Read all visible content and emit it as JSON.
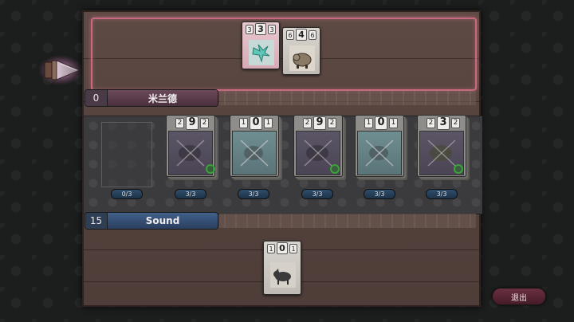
{
  "opponent": {
    "count": "0",
    "name": "米兰德",
    "hand": [
      {
        "left": "3",
        "mid": "3",
        "right": "3",
        "art": "cyan-bird-icon"
      },
      {
        "left": "6",
        "mid": "4",
        "right": "6",
        "art": "boar-icon"
      }
    ]
  },
  "player": {
    "count": "15",
    "name": "Sound",
    "hand": [
      {
        "left": "1",
        "mid": "0",
        "right": "1",
        "art": "wolf-icon"
      }
    ]
  },
  "slots": [
    {
      "counter": "0/3",
      "empty": true
    },
    {
      "counter": "3/3",
      "left": "2",
      "mid": "9",
      "right": "2",
      "art": "beast-icon"
    },
    {
      "counter": "3/3",
      "left": "1",
      "mid": "0",
      "right": "1",
      "art": "crossed-out-icon"
    },
    {
      "counter": "3/3",
      "left": "2",
      "mid": "9",
      "right": "2",
      "art": "beast-icon"
    },
    {
      "counter": "3/3",
      "left": "1",
      "mid": "0",
      "right": "1",
      "art": "crossed-out-icon"
    },
    {
      "counter": "3/3",
      "left": "2",
      "mid": "3",
      "right": "2",
      "art": "beast-icon"
    }
  ],
  "exit_label": "退出",
  "colors": {
    "opponent_glow": "#c86a7f",
    "player_bar": "#41608a",
    "opponent_bar": "#6b4a5a"
  }
}
